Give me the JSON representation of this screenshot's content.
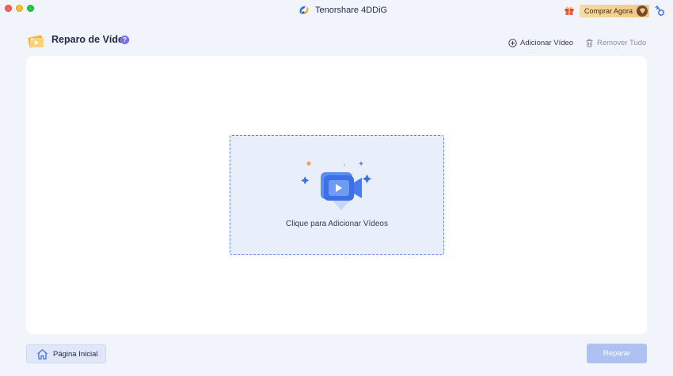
{
  "window": {
    "app_title": "Tenorshare 4DDiG",
    "buy_label": "Comprar Agora"
  },
  "header": {
    "title": "Reparo de Vídeo",
    "help": "?",
    "add_video_label": "Adicionar Vídeo",
    "remove_all_label": "Remover Tudo"
  },
  "dropzone": {
    "label": "Clique para Adicionar Vídeos"
  },
  "footer": {
    "home_label": "Página Inicial",
    "repair_label": "Reparar"
  },
  "colors": {
    "accent": "#3f6fe6",
    "buy_gradient": "#f5c77e",
    "repair_disabled": "#adc2f3"
  }
}
